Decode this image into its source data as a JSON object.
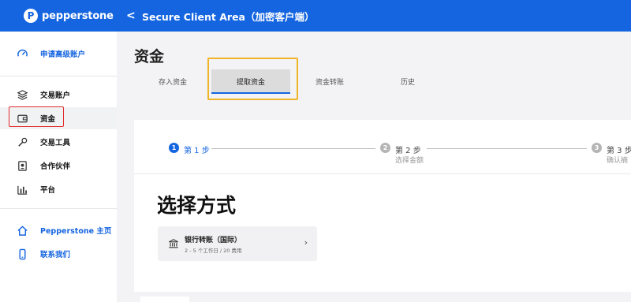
{
  "brand": {
    "name": "pepperstone",
    "mark": "P"
  },
  "sidebar": {
    "upgrade": {
      "label": "申请高级账户",
      "icon": "gauge-icon"
    },
    "items": [
      {
        "label": "交易账户",
        "icon": "layers-icon"
      },
      {
        "label": "资金",
        "icon": "wallet-icon",
        "active": true
      },
      {
        "label": "交易工具",
        "icon": "wrench-icon"
      },
      {
        "label": "合作伙伴",
        "icon": "contact-card-icon"
      },
      {
        "label": "平台",
        "icon": "bar-chart-icon"
      }
    ],
    "footer": [
      {
        "label": "Pepperstone 主页",
        "icon": "home-icon"
      },
      {
        "label": "联系我们",
        "icon": "phone-icon"
      }
    ]
  },
  "header": {
    "back_glyph": "<",
    "title": "Secure Client Area（加密客户端）"
  },
  "page": {
    "title": "资金"
  },
  "tabs": [
    {
      "label": "存入资金",
      "active": false
    },
    {
      "label": "提取资金",
      "active": true
    },
    {
      "label": "资金转账",
      "active": false
    },
    {
      "label": "历史",
      "active": false
    }
  ],
  "steps": [
    {
      "num": "1",
      "label": "第 1 步",
      "sub": "",
      "active": true
    },
    {
      "num": "2",
      "label": "第 2 步",
      "sub": "选择金额",
      "active": false
    },
    {
      "num": "3",
      "label": "第 3 步",
      "sub": "确认摘",
      "active": false
    }
  ],
  "method_section": {
    "title": "选择方式",
    "option": {
      "name": "银行转账（国际）",
      "detail": "2 - 5 个工作日 / 20 费用",
      "icon": "bank-icon",
      "chevron": "›"
    }
  },
  "colors": {
    "brand_blue": "#1565e0",
    "highlight_red": "#e22b2b",
    "highlight_yellow": "#f0b429"
  }
}
